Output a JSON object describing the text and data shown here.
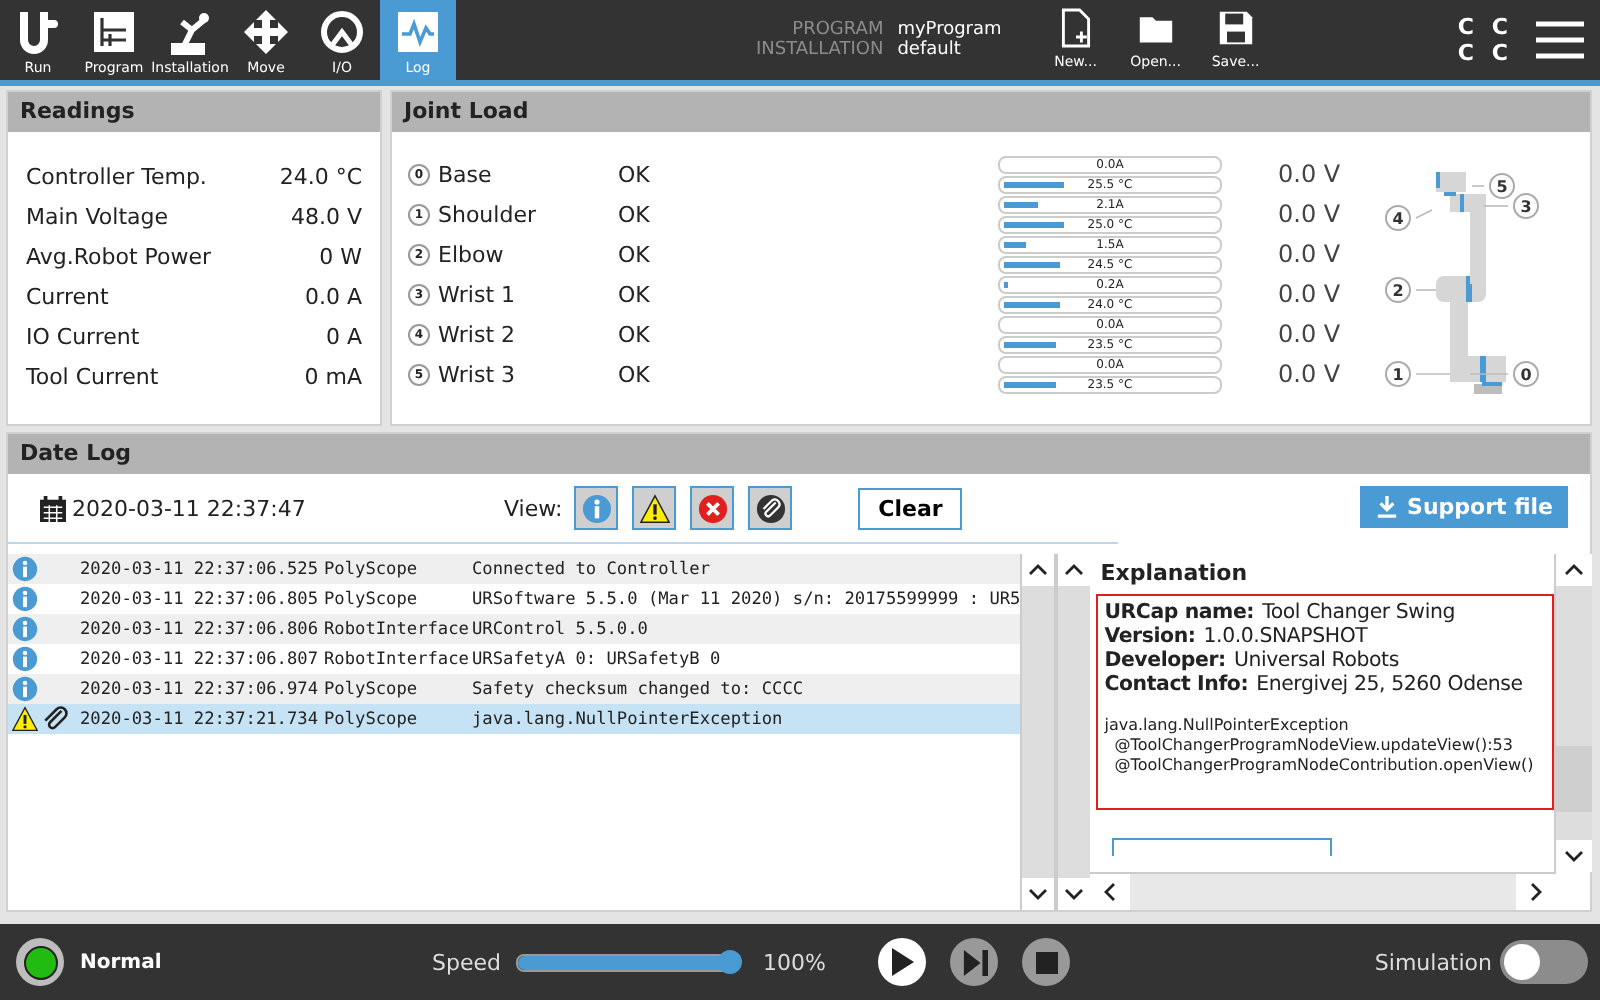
{
  "nav": [
    {
      "label": "Run",
      "kind": "logo",
      "selected": false
    },
    {
      "label": "Program",
      "kind": "program",
      "selected": false
    },
    {
      "label": "Installation",
      "kind": "arm",
      "selected": false
    },
    {
      "label": "Move",
      "kind": "move",
      "selected": false
    },
    {
      "label": "I/O",
      "kind": "gauge",
      "selected": false
    },
    {
      "label": "Log",
      "kind": "chart",
      "selected": true
    }
  ],
  "program": {
    "program_label": "PROGRAM",
    "program": "myProgram",
    "installation_label": "INSTALLATION",
    "installation": "default"
  },
  "file_buttons": [
    {
      "label": "New...",
      "kind": "new"
    },
    {
      "label": "Open...",
      "kind": "open"
    },
    {
      "label": "Save...",
      "kind": "save"
    }
  ],
  "corner_letters": [
    "C",
    "C",
    "C",
    "C"
  ],
  "readings": {
    "title": "Readings",
    "rows": [
      {
        "label": "Controller Temp.",
        "value": "24.0 °C"
      },
      {
        "label": "Main Voltage",
        "value": "48.0 V"
      },
      {
        "label": "Avg.Robot Power",
        "value": "0 W"
      },
      {
        "label": "Current",
        "value": "0.0 A"
      },
      {
        "label": "IO Current",
        "value": "0 A"
      },
      {
        "label": "Tool Current",
        "value": "0 mA"
      }
    ]
  },
  "joint_load": {
    "title": "Joint Load",
    "joints": [
      {
        "number": "0",
        "name": "Base",
        "status": "OK",
        "current": {
          "text": "0.0A",
          "level": 0
        },
        "temp": {
          "text": "25.5 °C",
          "level": 0.27
        },
        "voltage": "0.0 V"
      },
      {
        "number": "1",
        "name": "Shoulder",
        "status": "OK",
        "current": {
          "text": "2.1A",
          "level": 0.15
        },
        "temp": {
          "text": "25.0 °C",
          "level": 0.27
        },
        "voltage": "0.0 V"
      },
      {
        "number": "2",
        "name": "Elbow",
        "status": "OK",
        "current": {
          "text": "1.5A",
          "level": 0.1
        },
        "temp": {
          "text": "24.5 °C",
          "level": 0.25
        },
        "voltage": "0.0 V"
      },
      {
        "number": "3",
        "name": "Wrist 1",
        "status": "OK",
        "current": {
          "text": "0.2A",
          "level": 0.02
        },
        "temp": {
          "text": "24.0 °C",
          "level": 0.25
        },
        "voltage": "0.0 V"
      },
      {
        "number": "4",
        "name": "Wrist 2",
        "status": "OK",
        "current": {
          "text": "0.0A",
          "level": 0
        },
        "temp": {
          "text": "23.5 °C",
          "level": 0.24
        },
        "voltage": "0.0 V"
      },
      {
        "number": "5",
        "name": "Wrist 3",
        "status": "OK",
        "current": {
          "text": "0.0A",
          "level": 0
        },
        "temp": {
          "text": "23.5 °C",
          "level": 0.24
        },
        "voltage": "0.0 V"
      }
    ],
    "robot_markers": [
      "5",
      "3",
      "4",
      "2",
      "1",
      "0"
    ]
  },
  "log": {
    "title": "Date Log",
    "date": "2020-03-11 22:37:47",
    "view_label": "View:",
    "filters": [
      {
        "kind": "info"
      },
      {
        "kind": "warning"
      },
      {
        "kind": "error"
      },
      {
        "kind": "attachment"
      }
    ],
    "clear": "Clear",
    "support": "Support file",
    "entries": [
      {
        "kind": "info",
        "attachment": false,
        "time": "2020-03-11 22:37:06.525",
        "source": "PolyScope",
        "message": "Connected to Controller",
        "selected": false
      },
      {
        "kind": "info",
        "attachment": false,
        "time": "2020-03-11 22:37:06.805",
        "source": "PolyScope",
        "message": "URSoftware 5.5.0 (Mar 11 2020) s/n: 20175599999 : UR5",
        "selected": false
      },
      {
        "kind": "info",
        "attachment": false,
        "time": "2020-03-11 22:37:06.806",
        "source": "RobotInterface",
        "message": "URControl 5.5.0.0",
        "selected": false
      },
      {
        "kind": "info",
        "attachment": false,
        "time": "2020-03-11 22:37:06.807",
        "source": "RobotInterface",
        "message": "URSafetyA 0: URSafetyB 0",
        "selected": false
      },
      {
        "kind": "info",
        "attachment": false,
        "time": "2020-03-11 22:37:06.974",
        "source": "PolyScope",
        "message": "Safety checksum changed to: CCCC",
        "selected": false
      },
      {
        "kind": "warning",
        "attachment": true,
        "time": "2020-03-11 22:37:21.734",
        "source": "PolyScope",
        "message": "java.lang.NullPointerException",
        "selected": true
      }
    ],
    "explanation": {
      "title": "Explanation",
      "fields": [
        {
          "label": "URCap name:",
          "value": "Tool Changer Swing"
        },
        {
          "label": "Version:",
          "value": "1.0.0.SNAPSHOT"
        },
        {
          "label": "Developer:",
          "value": "Universal Robots"
        },
        {
          "label": "Contact Info:",
          "value": "Energivej 25, 5260 Odense"
        }
      ],
      "trace": [
        "java.lang.NullPointerException",
        "  @ToolChangerProgramNodeView.updateView():53",
        "  @ToolChangerProgramNodeContribution.openView()"
      ]
    }
  },
  "status": {
    "state": "Normal",
    "speed_label": "Speed",
    "speed": {
      "level": 1
    },
    "speed_text": "100%",
    "simulation_label": "Simulation",
    "simulation_on": false
  }
}
